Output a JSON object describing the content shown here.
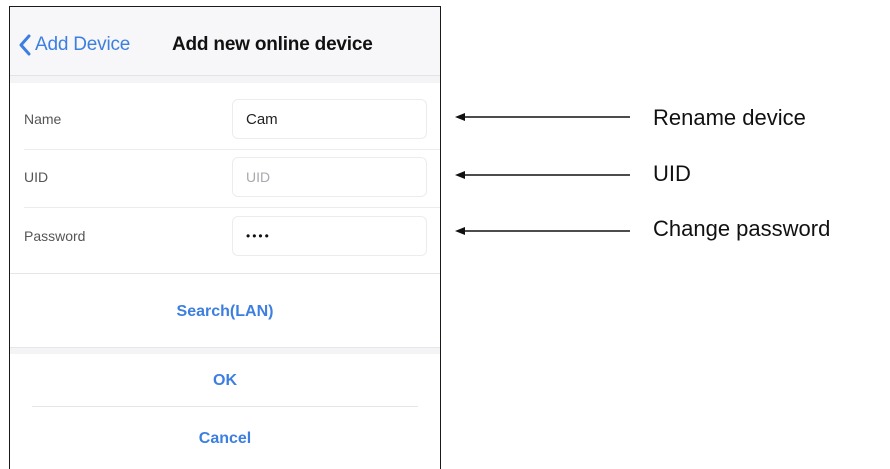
{
  "navbar": {
    "back_label": "Add Device",
    "title": "Add new online device"
  },
  "form": {
    "name": {
      "label": "Name",
      "value": "Cam"
    },
    "uid": {
      "label": "UID",
      "placeholder": "UID"
    },
    "password": {
      "label": "Password",
      "value": "••••"
    }
  },
  "actions": {
    "search": "Search(LAN)",
    "ok": "OK",
    "cancel": "Cancel"
  },
  "annotations": {
    "rename": "Rename device",
    "uid": "UID",
    "change_password": "Change password"
  },
  "colors": {
    "accent": "#3c7fe0",
    "background": "#f4f4f6"
  }
}
